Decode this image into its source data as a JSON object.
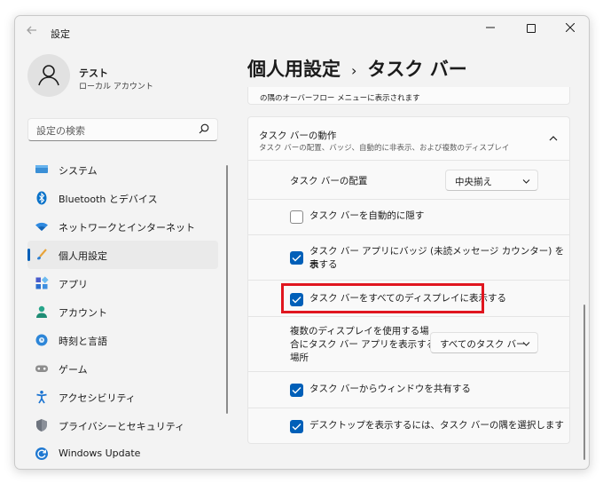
{
  "window": {
    "title": "設定"
  },
  "user": {
    "name": "テスト",
    "account_type": "ローカル アカウント"
  },
  "search": {
    "placeholder": "設定の検索"
  },
  "nav": [
    {
      "label": "システム",
      "icon": "monitor-icon",
      "selected": false
    },
    {
      "label": "Bluetooth とデバイス",
      "icon": "bluetooth-icon",
      "selected": false
    },
    {
      "label": "ネットワークとインターネット",
      "icon": "wifi-icon",
      "selected": false
    },
    {
      "label": "個人用設定",
      "icon": "brush-icon",
      "selected": true
    },
    {
      "label": "アプリ",
      "icon": "apps-icon",
      "selected": false
    },
    {
      "label": "アカウント",
      "icon": "person-icon",
      "selected": false
    },
    {
      "label": "時刻と言語",
      "icon": "globe-clock-icon",
      "selected": false
    },
    {
      "label": "ゲーム",
      "icon": "gamepad-icon",
      "selected": false
    },
    {
      "label": "アクセシビリティ",
      "icon": "accessibility-icon",
      "selected": false
    },
    {
      "label": "プライバシーとセキュリティ",
      "icon": "shield-icon",
      "selected": false
    },
    {
      "label": "Windows Update",
      "icon": "update-icon",
      "selected": false
    }
  ],
  "breadcrumb": {
    "parent": "個人用設定",
    "separator": "›",
    "current": "タスク バー"
  },
  "previous_card_text": "の隅のオーバーフロー メニューに表示されます",
  "section": {
    "title": "タスク バーの動作",
    "description": "タスク バーの配置、バッジ、自動的に非表示、および複数のディスプレイ"
  },
  "alignment": {
    "label": "タスク バーの配置",
    "value": "中央揃え"
  },
  "options": {
    "auto_hide": {
      "label": "タスク バーを自動的に隠す",
      "checked": false
    },
    "badges": {
      "line1": "タスク バー アプリにバッジ (未読メッセージ カウンター) を表",
      "line2": "示する",
      "checked": true
    },
    "all_displays": {
      "label": "タスク バーをすべてのディスプレイに表示する",
      "checked": true
    },
    "share_window": {
      "label": "タスク バーからウィンドウを共有する",
      "checked": true
    },
    "desktop_corner": {
      "label": "デスクトップを表示するには、タスク バーの隅を選択します",
      "checked": true
    }
  },
  "multi_display": {
    "line1": "複数のディスプレイを使用する場",
    "line2": "合にタスク バー アプリを表示する",
    "line3": "場所",
    "value": "すべてのタスク バー"
  },
  "colors": {
    "accent": "#005fb8",
    "highlight": "#e0161f"
  }
}
